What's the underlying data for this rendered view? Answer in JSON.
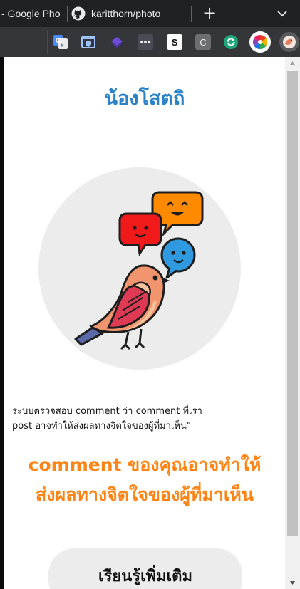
{
  "browser": {
    "tabs": [
      {
        "label": "- Google Pho"
      },
      {
        "label": "karitthorn/photo"
      }
    ],
    "new_tab_glyph": "+",
    "extensions": [
      {
        "icon": "google-translate-icon"
      },
      {
        "icon": "shield-extension-icon"
      },
      {
        "icon": "purple-layers-icon"
      },
      {
        "icon": "dots-extension-icon"
      },
      {
        "icon": "s-extension-icon",
        "letter": "S"
      },
      {
        "icon": "c-extension-icon",
        "letter": "C"
      },
      {
        "icon": "green-refresh-icon"
      },
      {
        "icon": "color-wheel-icon"
      },
      {
        "icon": "bird-extension-icon"
      }
    ]
  },
  "popup": {
    "title": "น้องโสตถิ",
    "description_line1": "ระบบตรวจสอบ comment ว่า comment ที่เรา",
    "description_line2": "post อาจทำให้ส่งผลทางจิตใจของผู้ที่มาเห็น\"",
    "warning_line1": "comment ของคุณอาจทำให้",
    "warning_line2": "ส่งผลทางจิตใจของผู้ที่มาเห็น",
    "learn_more_label": "เรียนรู้เพิ่มเติม"
  },
  "colors": {
    "title": "#2a82c8",
    "warning": "#ff8416",
    "circle": "#ececec",
    "bubble_red": "#f01a1a",
    "bubble_orange": "#ff8a00",
    "bubble_blue": "#2f9ae0"
  }
}
